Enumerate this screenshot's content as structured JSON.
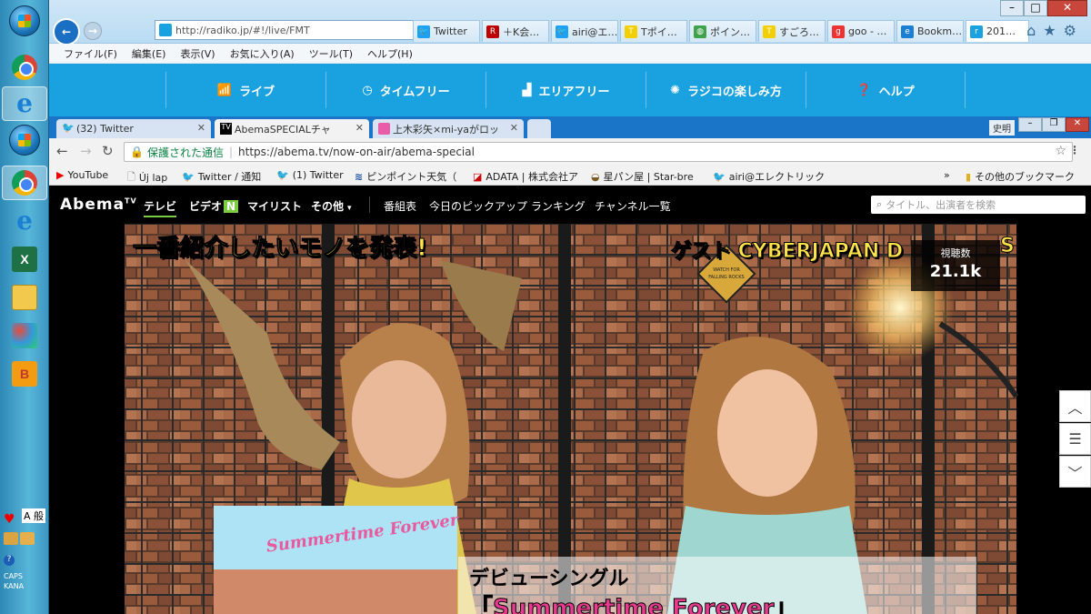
{
  "taskbar": {
    "items": [
      "start-orb",
      "chrome",
      "internet-explorer",
      "start-orb",
      "chrome",
      "internet-explorer",
      "excel",
      "file-explorer",
      "paint",
      "shortcut"
    ],
    "tray": {
      "ime_label": "A 般",
      "caps": "CAPS",
      "kana": "KANA"
    }
  },
  "ie": {
    "address": "http://radiko.jp/#!/live/FMT",
    "tabs": [
      {
        "label": "Twitter",
        "icon": "twitter-bird"
      },
      {
        "label": "＋K会…",
        "icon": "rakuten"
      },
      {
        "label": "airi@エ…",
        "icon": "twitter-bird"
      },
      {
        "label": "Tポイ…",
        "icon": "tpoint"
      },
      {
        "label": "ポイン…",
        "icon": "globe"
      },
      {
        "label": "すごろ…",
        "icon": "tpoint"
      },
      {
        "label": "goo - …",
        "icon": "goo"
      },
      {
        "label": "Bookm…",
        "icon": "ie"
      },
      {
        "label": "201…",
        "icon": "radiko"
      }
    ],
    "menu": [
      "ファイル(F)",
      "編集(E)",
      "表示(V)",
      "お気に入り(A)",
      "ツール(T)",
      "ヘルプ(H)"
    ]
  },
  "radiko": {
    "nav": [
      "ライブ",
      "タイムフリー",
      "エリアフリー",
      "ラジコの楽しみ方",
      "ヘルプ"
    ]
  },
  "chrome": {
    "tabs": [
      {
        "label": "(32) Twitter"
      },
      {
        "label": "AbemaSPECIALチャ"
      },
      {
        "label": "上木彩矢×mi-yaがロッ"
      }
    ],
    "user_label": "史明",
    "secure_label": "保護された通信",
    "url": "https://abema.tv/now-on-air/abema-special",
    "bookmarks": [
      "YouTube",
      "Új lap",
      "Twitter / 通知",
      "(1) Twitter",
      "ピンポイント天気（",
      "ADATA | 株式会社ア",
      "星パン屋 | Star-bre",
      "airi@エレクトリック"
    ],
    "other_bookmarks": "その他のブックマーク"
  },
  "abema": {
    "logo": "Abema",
    "logo_sup": "TV",
    "nav_main": [
      "テレビ",
      "ビデオ",
      "マイリスト",
      "その他"
    ],
    "video_badge": "N",
    "nav_sub": [
      "番組表",
      "今日のピックアップ",
      "ランキング",
      "チャンネル一覧"
    ],
    "search_placeholder": "タイトル、出演者を検索",
    "viewers_label": "視聴数",
    "viewers_value": "21.1k"
  },
  "video": {
    "caption_left": "一番紹介したいモノを発表!",
    "caption_right": "ゲスト CYBERJAPAN D",
    "caption_right_tail": "S",
    "sign_text": "WATCH FOR FALLING ROCKS",
    "album_title": "Summertime Forever",
    "debut_label": "デビューシングル",
    "single_title": "「Summertime Forever」"
  }
}
